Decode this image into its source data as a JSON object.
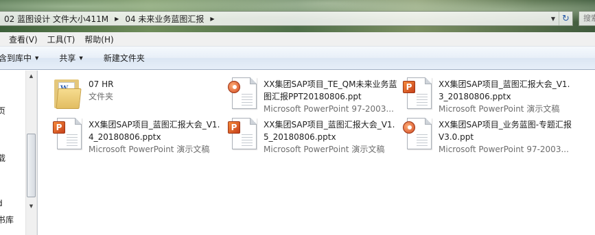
{
  "address": {
    "crumbs": [
      "02 蓝图设计 文件大小411M",
      "04 未来业务蓝图汇报"
    ],
    "search_placeholder": "搜索"
  },
  "menu": [
    "查看(V)",
    "工具(T)",
    "帮助(H)"
  ],
  "commands": [
    {
      "label": "包含到库中",
      "dropdown": true
    },
    {
      "label": "共享",
      "dropdown": true
    },
    {
      "label": "新建文件夹",
      "dropdown": false
    }
  ],
  "nav_pane": {
    "visible_fragments": [
      "页",
      "载",
      "d",
      "书库"
    ]
  },
  "files": [
    {
      "name": "07 HR",
      "type": "文件夹",
      "icon": "folder-icon"
    },
    {
      "name": "XX集团SAP项目_TE_QM未来业务蓝图汇报PPT20180806.ppt",
      "type": "Microsoft PowerPoint 97-2003...",
      "icon": "ppt-icon"
    },
    {
      "name": "XX集团SAP项目_蓝图汇报大会_V1.3_20180806.pptx",
      "type": "Microsoft PowerPoint 演示文稿",
      "icon": "pptx-icon"
    },
    {
      "name": "XX集团SAP项目_蓝图汇报大会_V1.4_20180806.pptx",
      "type": "Microsoft PowerPoint 演示文稿",
      "icon": "pptx-icon"
    },
    {
      "name": "XX集团SAP项目_蓝图汇报大会_V1.5_20180806.pptx",
      "type": "Microsoft PowerPoint 演示文稿",
      "icon": "pptx-icon"
    },
    {
      "name": "XX集团SAP项目_业务蓝图-专题汇报V3.0.ppt",
      "type": "Microsoft PowerPoint 97-2003...",
      "icon": "ppt-icon"
    }
  ]
}
